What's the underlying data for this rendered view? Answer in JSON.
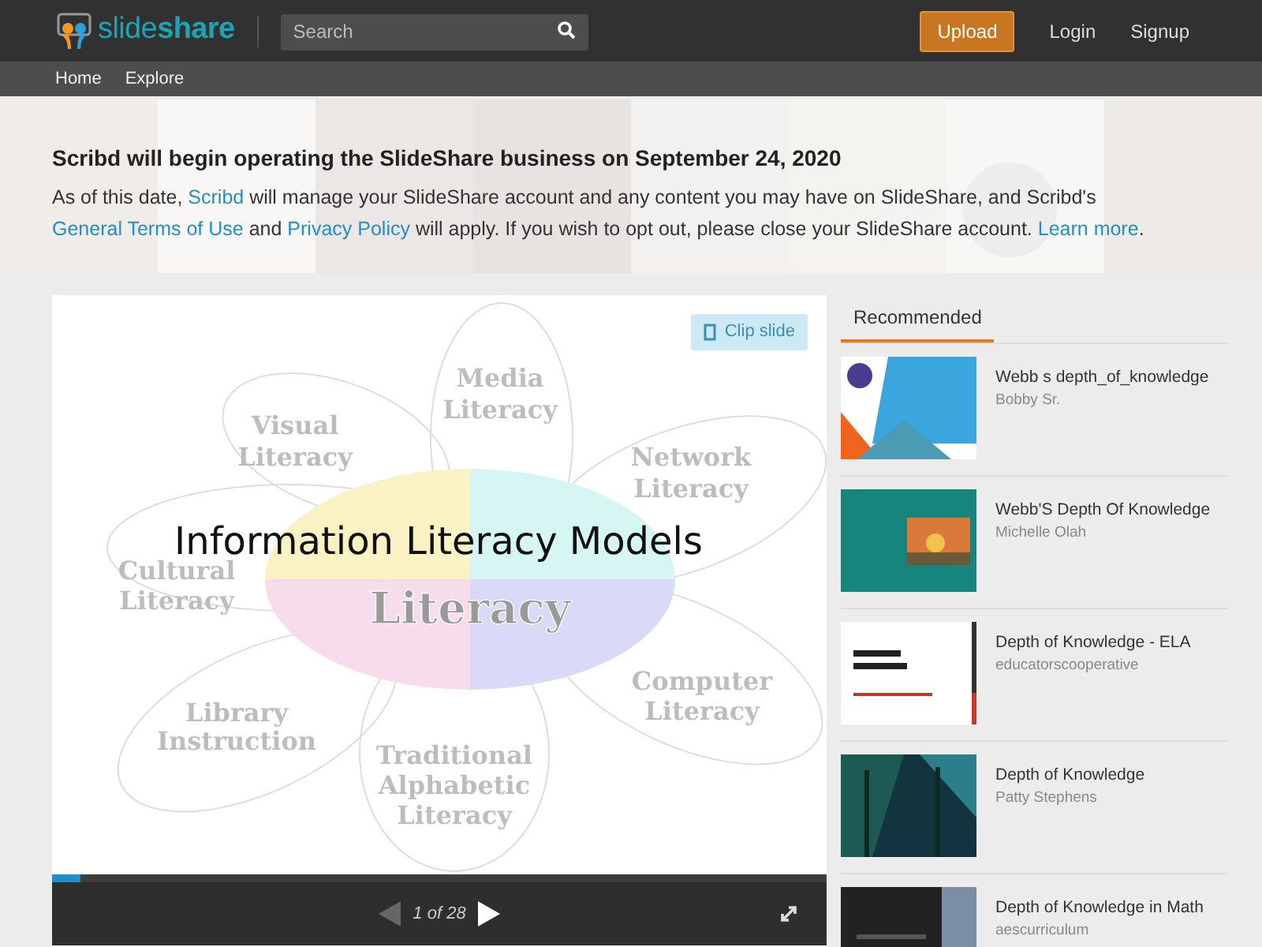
{
  "header": {
    "logo": "slide**share**",
    "search": {
      "placeholder": "Search"
    },
    "upload": "Upload",
    "links": [
      "Login",
      "Signup"
    ]
  },
  "subnav": [
    "Home",
    "Explore"
  ],
  "notice": {
    "title": "Scribd will begin operating the SlideShare business on September 24, 2020",
    "body": [
      {
        "text": "As of this date, ",
        "link": false
      },
      {
        "text": "Scribd",
        "link": true
      },
      {
        "text": " will manage your SlideShare account and any content you may have on SlideShare, and Scribd's ",
        "link": false
      },
      {
        "text": "General Terms of Use",
        "link": true
      },
      {
        "text": " and ",
        "link": false
      },
      {
        "text": "Privacy Policy",
        "link": true
      },
      {
        "text": " will apply. If you wish to opt out, please close your SlideShare account. ",
        "link": false
      },
      {
        "text": "Learn more",
        "link": true
      },
      {
        "text": ".",
        "link": false
      }
    ]
  },
  "player": {
    "clip_button": "Clip slide",
    "slide": {
      "title": "Information Literacy Models",
      "labels": [
        {
          "lines": [
            "Media",
            "Literacy"
          ]
        },
        {
          "lines": [
            "Visual",
            "Literacy"
          ]
        },
        {
          "lines": [
            "Network",
            "Literacy"
          ]
        },
        {
          "lines": [
            "Cultural",
            "Literacy"
          ]
        },
        {
          "lines": [
            "Literacy"
          ]
        },
        {
          "lines": [
            "Computer",
            "Literacy"
          ]
        },
        {
          "lines": [
            "Library",
            "Instruction"
          ]
        },
        {
          "lines": [
            "Traditional",
            "Alphabetic",
            "Literacy"
          ]
        }
      ]
    },
    "progress": {
      "level": 0.036
    },
    "counter": "1 of 28",
    "prev_disabled": true
  },
  "recommended": {
    "tab": "Recommended",
    "items": [
      {
        "title": "Webb s depth_of_knowledge",
        "author": "Bobby Sr."
      },
      {
        "title": "Webb'S Depth Of Knowledge",
        "author": "Michelle Olah"
      },
      {
        "title": "Depth of Knowledge - ELA",
        "author": "educatorscooperative"
      },
      {
        "title": "Depth of Knowledge",
        "author": "Patty Stephens"
      },
      {
        "title": "Depth of Knowledge in Math",
        "author": "aescurriculum"
      }
    ]
  }
}
